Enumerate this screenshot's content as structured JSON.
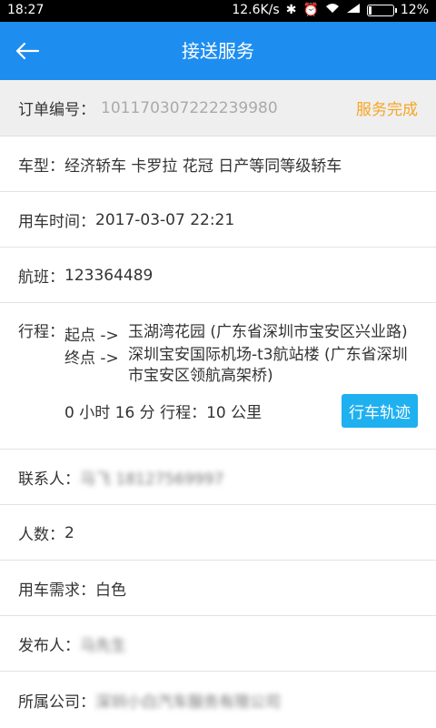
{
  "status_bar": {
    "time": "18:27",
    "network_speed": "12.6K/s",
    "battery": "12%",
    "battery_level": 0.12
  },
  "header": {
    "title": "接送服务",
    "color": "#1e8df0"
  },
  "order": {
    "label": "订单编号：",
    "number": "101170307222239980",
    "status": "服务完成"
  },
  "details": {
    "car_type_label": "车型：",
    "car_type": "经济轿车 卡罗拉 花冠 日产等同等级轿车",
    "time_label": "用车时间：",
    "time": "2017-03-07 22:21",
    "flight_label": "航班：",
    "flight": "123364489",
    "trip_label": "行程：",
    "start_tag": "起点 ->",
    "start": "玉湖湾花园 (广东省深圳市宝安区兴业路)",
    "end_tag": "终点 ->",
    "end": "深圳宝安国际机场-t3航站楼 (广东省深圳市宝安区领航高架桥)",
    "summary": "0 小时 16 分 行程：10 公里",
    "track_button": "行车轨迹",
    "contact_label": "联系人：",
    "contact": "马飞 18127569997",
    "people_label": "人数：",
    "people": "2",
    "requirement_label": "用车需求：",
    "requirement": "白色",
    "publisher_label": "发布人：",
    "publisher": "马先生",
    "company_label": "所属公司：",
    "company": "深圳小白汽车服务有限公司"
  }
}
